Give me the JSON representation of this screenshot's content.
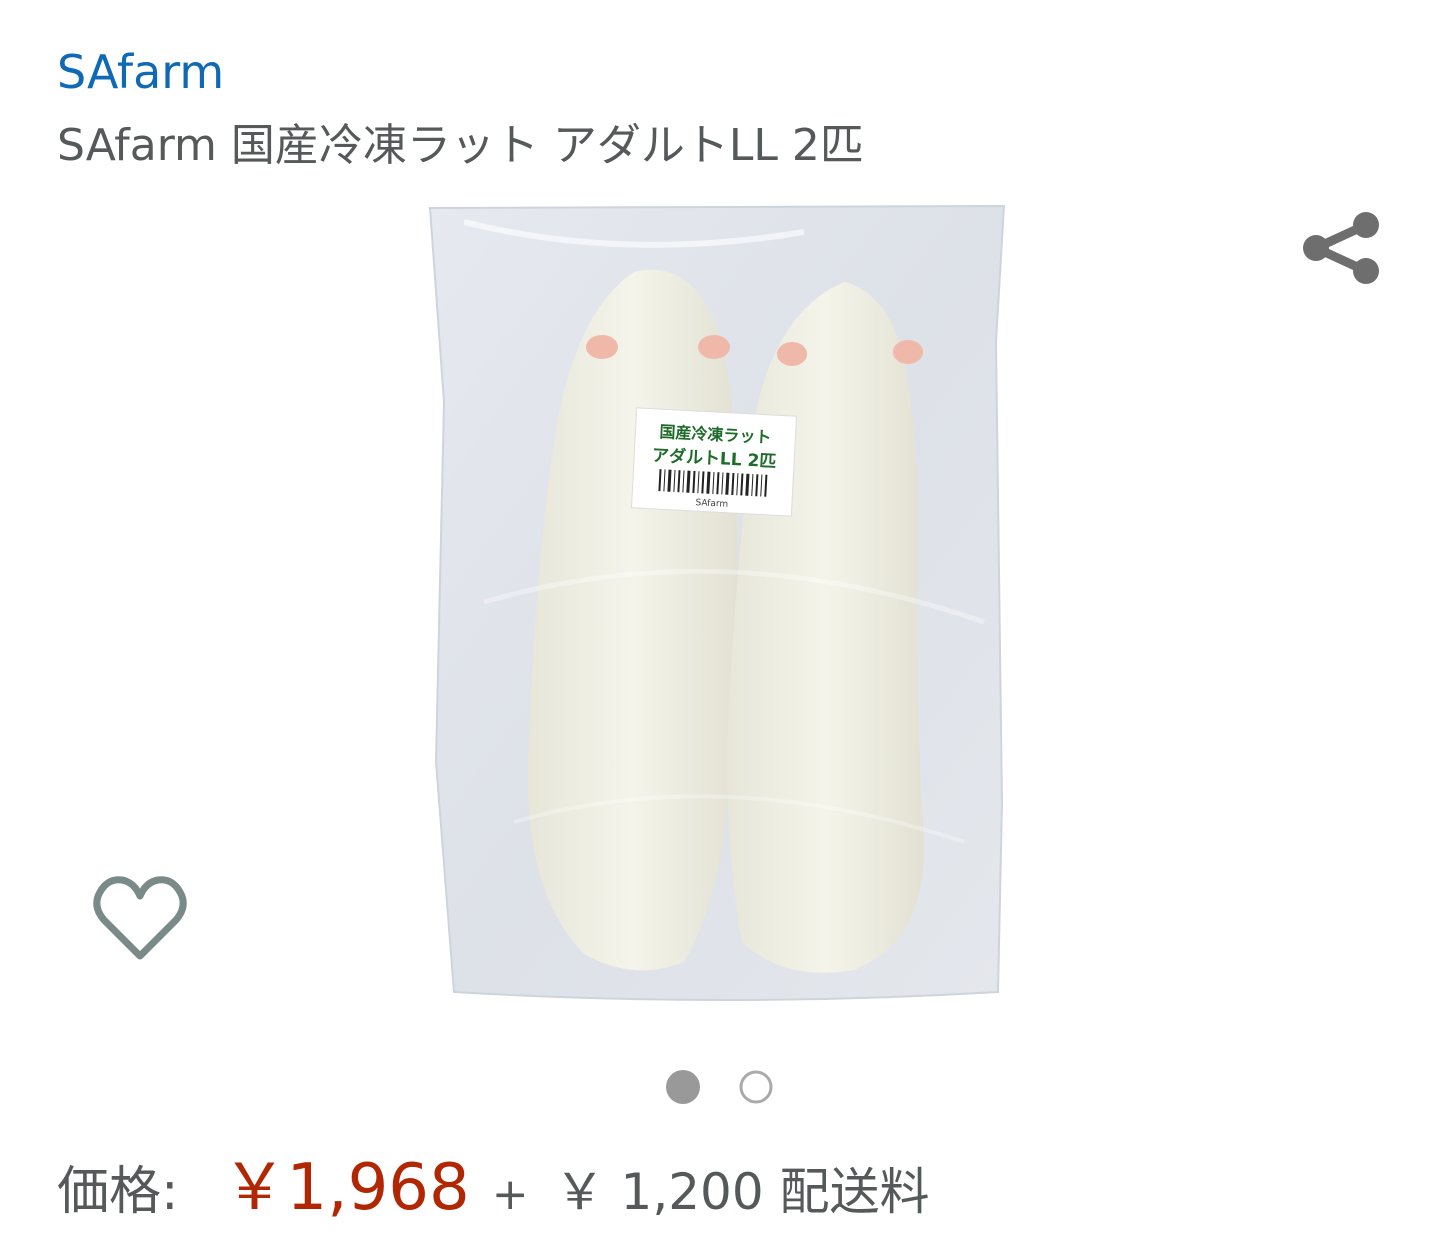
{
  "brand": {
    "name": "SAfarm"
  },
  "product": {
    "title": "SAfarm 国産冷凍ラット アダルトLL 2匹",
    "image_icon": "product-photo",
    "package_label": {
      "line1": "国産冷凍ラット",
      "line2": "アダルトLL 2匹",
      "maker": "SAfarm"
    }
  },
  "actions": {
    "share_icon": "share-icon",
    "wishlist_icon": "heart-outline-icon"
  },
  "carousel": {
    "total": 2,
    "active_index": 0
  },
  "price": {
    "label": "価格:",
    "value": "￥1,968",
    "shipping_plus": "+",
    "shipping": "￥ 1,200 配送料"
  },
  "colors": {
    "brand_link": "#0f69b4",
    "price": "#b12704",
    "text_muted": "#565959",
    "icon": "#7a8a88"
  }
}
